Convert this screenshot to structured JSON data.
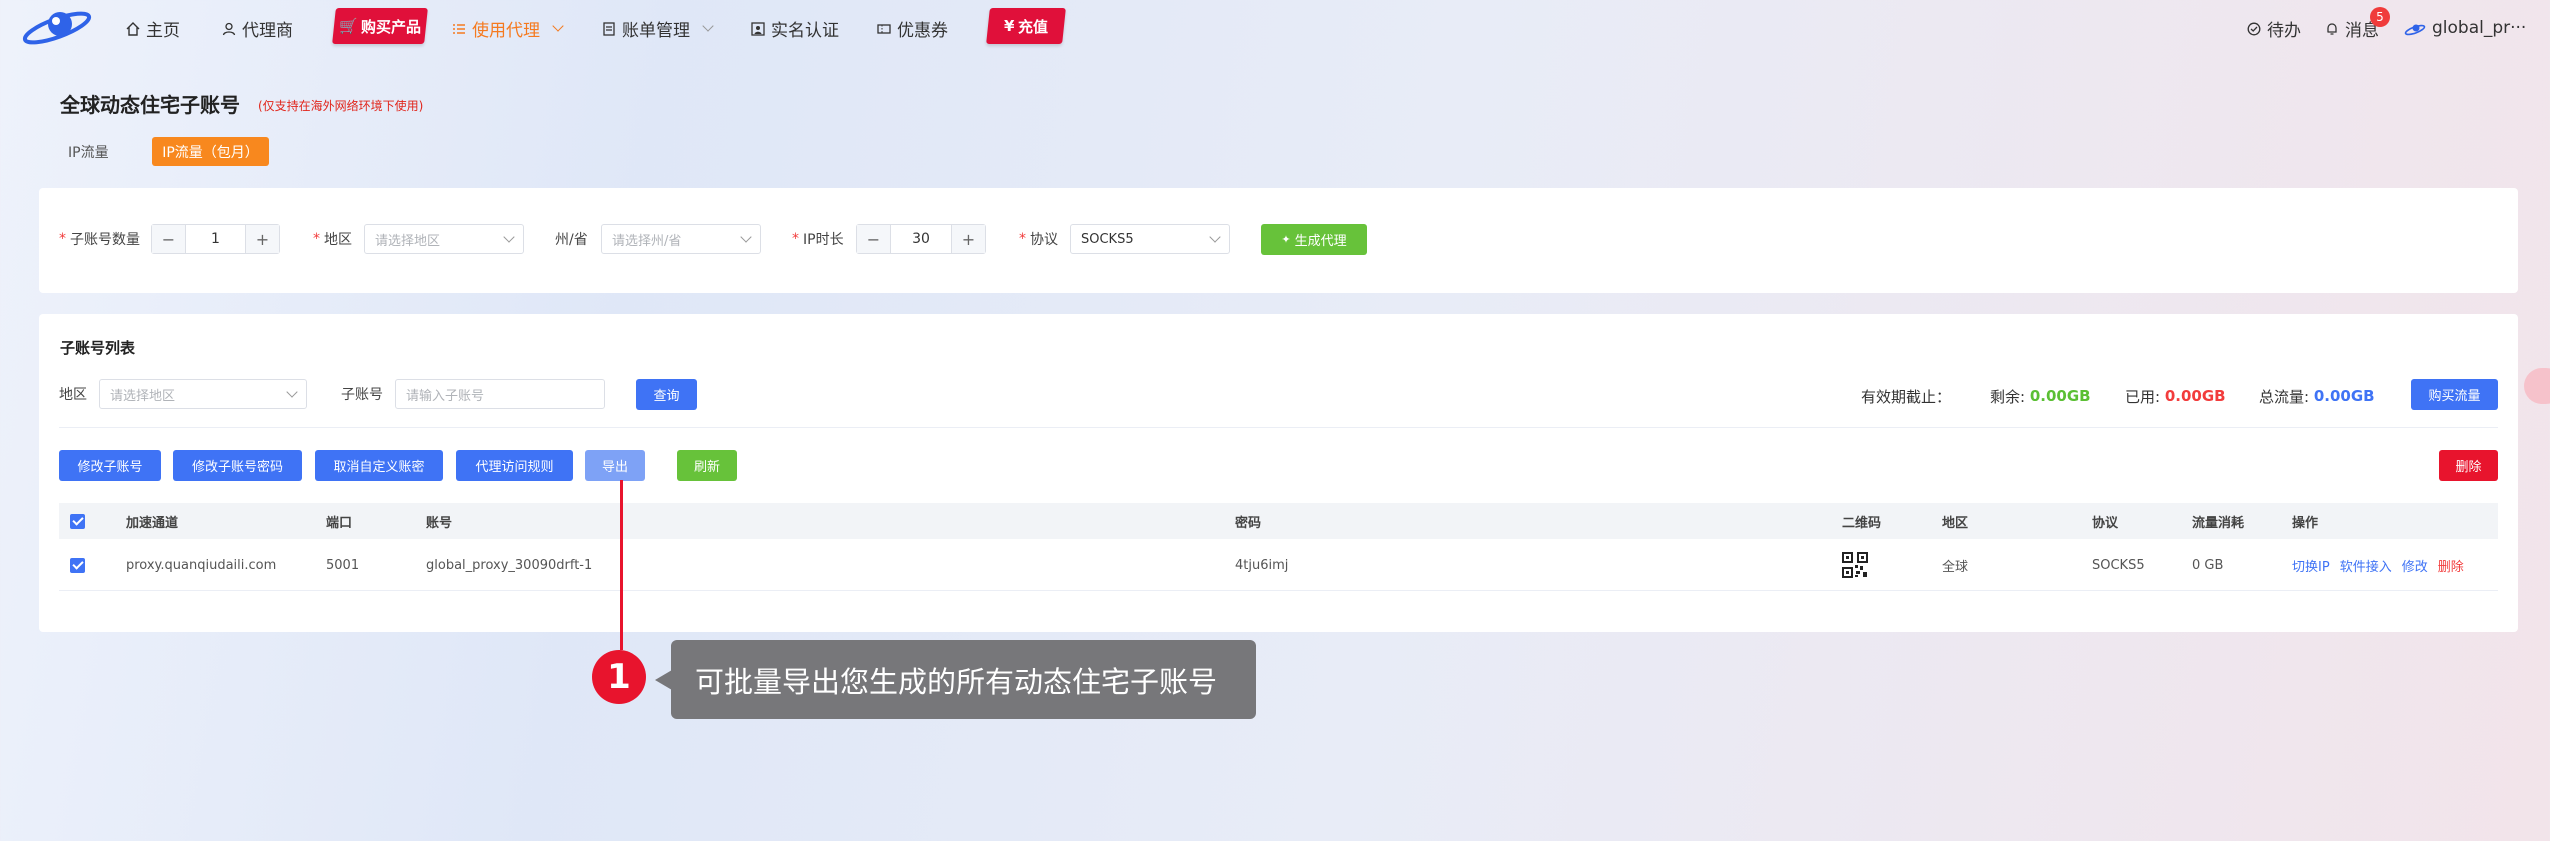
{
  "nav": {
    "items": {
      "home": "主页",
      "agent": "代理商",
      "buy": "购买产品",
      "use_proxy": "使用代理",
      "bills": "账单管理",
      "verify": "实名认证",
      "coupons": "优惠券",
      "recharge": "充值"
    },
    "recharge_symbol": "¥",
    "todo": "待办",
    "messages": "消息",
    "message_count": "5",
    "username": "global_pr···"
  },
  "page": {
    "title": "全球动态住宅子账号",
    "note": "(仅支持在海外网络环境下使用)",
    "tabs": [
      "IP流量",
      "IP流量（包月）"
    ]
  },
  "generator": {
    "count_label": "子账号数量",
    "count_value": "1",
    "region_label": "地区",
    "region_placeholder": "请选择地区",
    "state_label": "州/省",
    "state_placeholder": "请选择州/省",
    "duration_label": "IP时长",
    "duration_value": "30",
    "protocol_label": "协议",
    "protocol_value": "SOCKS5",
    "generate_label": "生成代理"
  },
  "list": {
    "title": "子账号列表",
    "region_label": "地区",
    "region_placeholder": "请选择地区",
    "account_label": "子账号",
    "account_placeholder": "请输入子账号",
    "query_label": "查询",
    "expiry_label": "有效期截止：",
    "remaining_label": "剩余:",
    "remaining_value": "0.00GB",
    "used_label": "已用:",
    "used_value": "0.00GB",
    "total_label": "总流量:",
    "total_value": "0.00GB",
    "buy_traffic_label": "购买流量",
    "actions": {
      "edit_account": "修改子账号",
      "edit_password": "修改子账号密码",
      "cancel_custom": "取消自定义账密",
      "access_rules": "代理访问规则",
      "export": "导出",
      "refresh": "刷新",
      "delete": "删除"
    },
    "columns": [
      "加速通道",
      "端口",
      "账号",
      "密码",
      "二维码",
      "地区",
      "协议",
      "流量消耗",
      "操作"
    ],
    "rows": [
      {
        "channel": "proxy.quanqiudaili.com",
        "port": "5001",
        "account": "global_proxy_30090drft-1",
        "password": "4tju6imj",
        "region": "全球",
        "protocol": "SOCKS5",
        "traffic": "0 GB",
        "ops": [
          "切换IP",
          "软件接入",
          "修改",
          "删除"
        ]
      }
    ]
  },
  "annotation": {
    "number": "1",
    "text": "可批量导出您生成的所有动态住宅子账号"
  },
  "colors": {
    "accent_orange": "#f8881e",
    "primary_blue": "#3f73f5",
    "success_green": "#67c23a",
    "danger_red": "#e8142d"
  }
}
